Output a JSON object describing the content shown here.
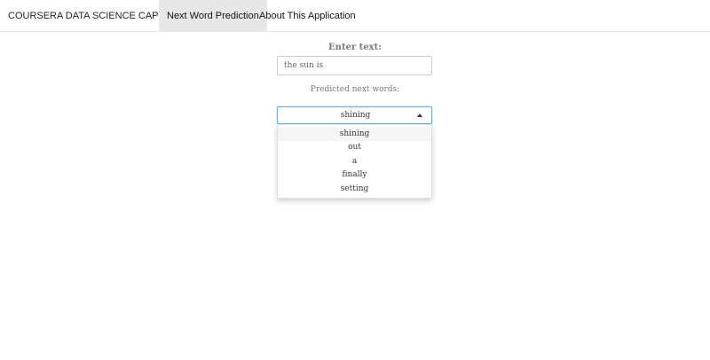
{
  "navbar": {
    "brand": "COURSERA DATA SCIENCE CAPSTONE",
    "tabs": [
      {
        "label": "Next Word Prediction",
        "active": true
      },
      {
        "label": "About This Application",
        "active": false
      }
    ]
  },
  "form": {
    "input_label": "Enter text:",
    "input_value": "the sun is",
    "prediction_label": "Predicted next words:",
    "selected": "shining",
    "options": [
      "shining",
      "out",
      "a",
      "finally",
      "setting"
    ]
  },
  "colors": {
    "active_tab_bg": "#e7e7e7",
    "focus_border": "#66afe9"
  }
}
